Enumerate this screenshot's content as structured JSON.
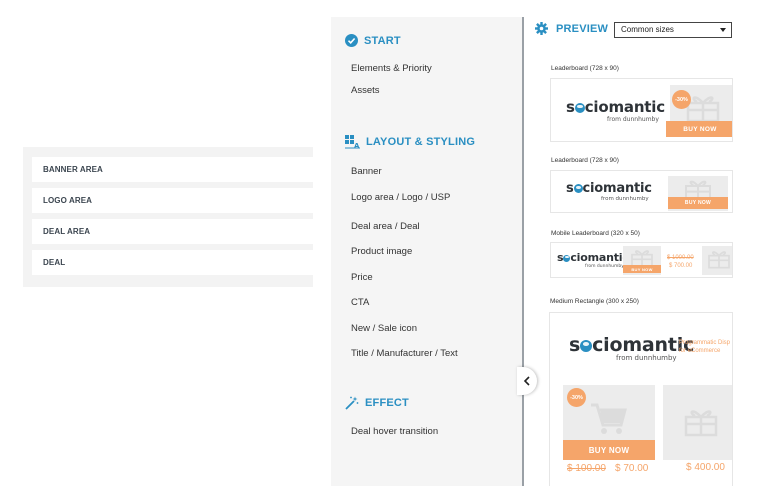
{
  "areas": {
    "items": [
      "BANNER AREA",
      "LOGO AREA",
      "DEAL AREA",
      "DEAL"
    ]
  },
  "nav": {
    "start": {
      "title": "START",
      "icon": "check-circle-icon",
      "items": [
        "Elements & Priority",
        "Assets"
      ]
    },
    "layout": {
      "title": "LAYOUT & STYLING",
      "icon": "layout-icon",
      "items": [
        "Banner",
        "Logo area / Logo / USP",
        "Deal area / Deal",
        "Product image",
        "Price",
        "CTA",
        "New / Sale icon",
        "Title / Manufacturer / Text"
      ]
    },
    "effect": {
      "title": "EFFECT",
      "icon": "magic-wand-icon",
      "items": [
        "Deal hover transition"
      ]
    },
    "collapse_icon": "chevron-left-icon"
  },
  "preview": {
    "title": "PREVIEW",
    "icon": "gear-icon",
    "size_select": "Common sizes",
    "brand": {
      "name_pre": "s",
      "name_post": "ciomantic",
      "sub": "from dunnhumby"
    },
    "ads": [
      {
        "label": "Leaderboard (728 x 90)",
        "badge": "-30%",
        "cta": "BUY NOW"
      },
      {
        "label": "Leaderboard (728 x 90)",
        "cta": "BUY NOW"
      },
      {
        "label": "Mobile Leaderboard (320 x 50)",
        "cta": "BUY NOW",
        "price_old": "$ 1000.00",
        "price_new": "$ 700.00"
      },
      {
        "label": "Medium Rectangle (300 x 250)",
        "tagline_1": "Programmatic Disp",
        "tagline_2": "for eCommerce",
        "badge": "-30%",
        "cta": "BUY NOW",
        "price_old": "$ 100.00",
        "price_new": "$ 70.00",
        "price_2": "$ 400.00"
      }
    ],
    "colors": {
      "accent": "#2a8fc2",
      "deal": "#f5a56a"
    }
  }
}
